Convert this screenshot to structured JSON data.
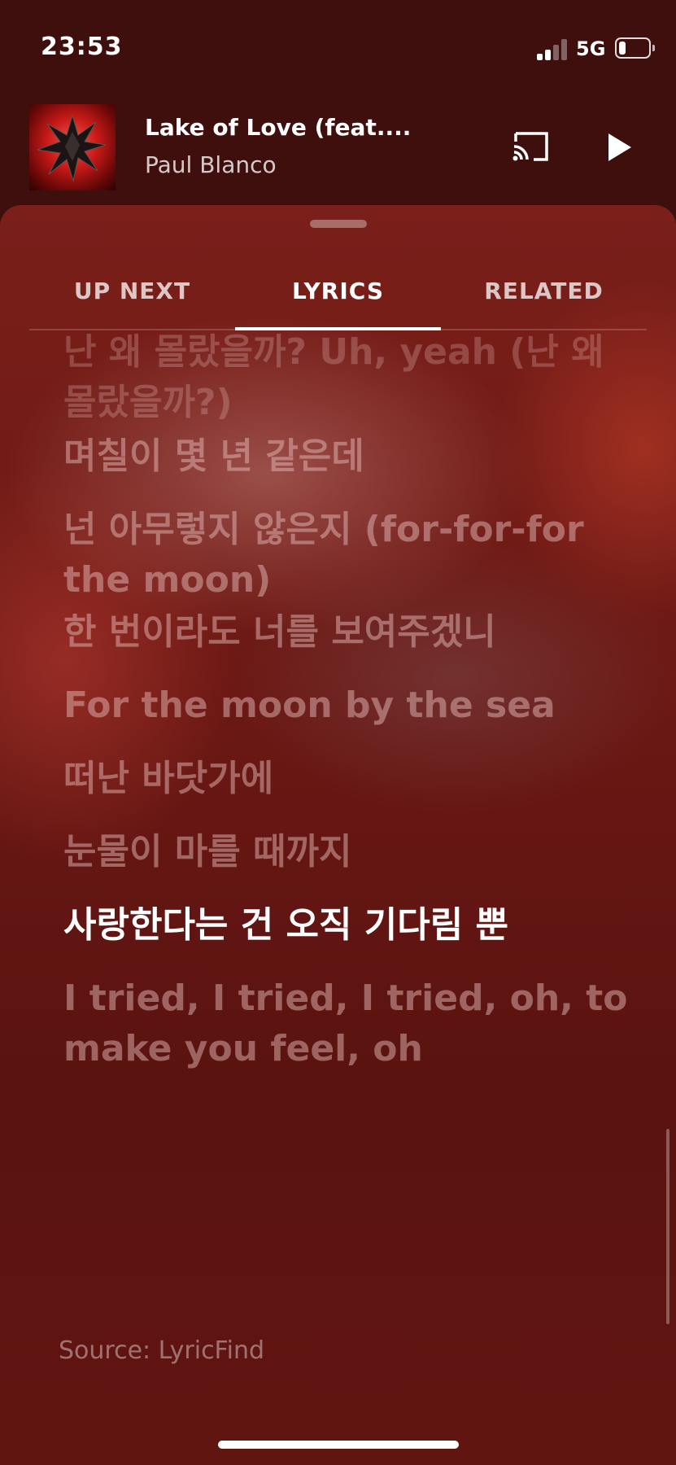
{
  "status_bar": {
    "time": "23:53",
    "network": "5G",
    "battery_level": 0.25
  },
  "player": {
    "title": "Lake of Love (feat....",
    "artist": "Paul Blanco"
  },
  "tabs": [
    {
      "label": "UP NEXT",
      "active": false
    },
    {
      "label": "LYRICS",
      "active": true
    },
    {
      "label": "RELATED",
      "active": false
    }
  ],
  "lyrics": {
    "lines": [
      "난 왜 몰랐을까? Uh, yeah (난 왜 몰랐을까?)",
      "며칠이 몇 년 같은데",
      "넌 아무렇지 않은지 (for-for-for the moon)",
      "한 번이라도 너를 보여주겠니",
      "For the moon by the sea",
      "떠난 바닷가에",
      "눈물이 마를 때까지",
      "사랑한다는 건 오직 기다림 뿐",
      "I tried, I tried, I tried, oh, to make you feel, oh"
    ],
    "current_index": 7,
    "source": "Source: LyricFind"
  },
  "icons": {
    "cast": "cast-icon",
    "play": "play-icon",
    "signal": "signal-icon",
    "battery": "battery-icon"
  },
  "colors": {
    "background": "#3f0f0e",
    "sheet": "#6b1814",
    "active_text": "#ffffff"
  }
}
